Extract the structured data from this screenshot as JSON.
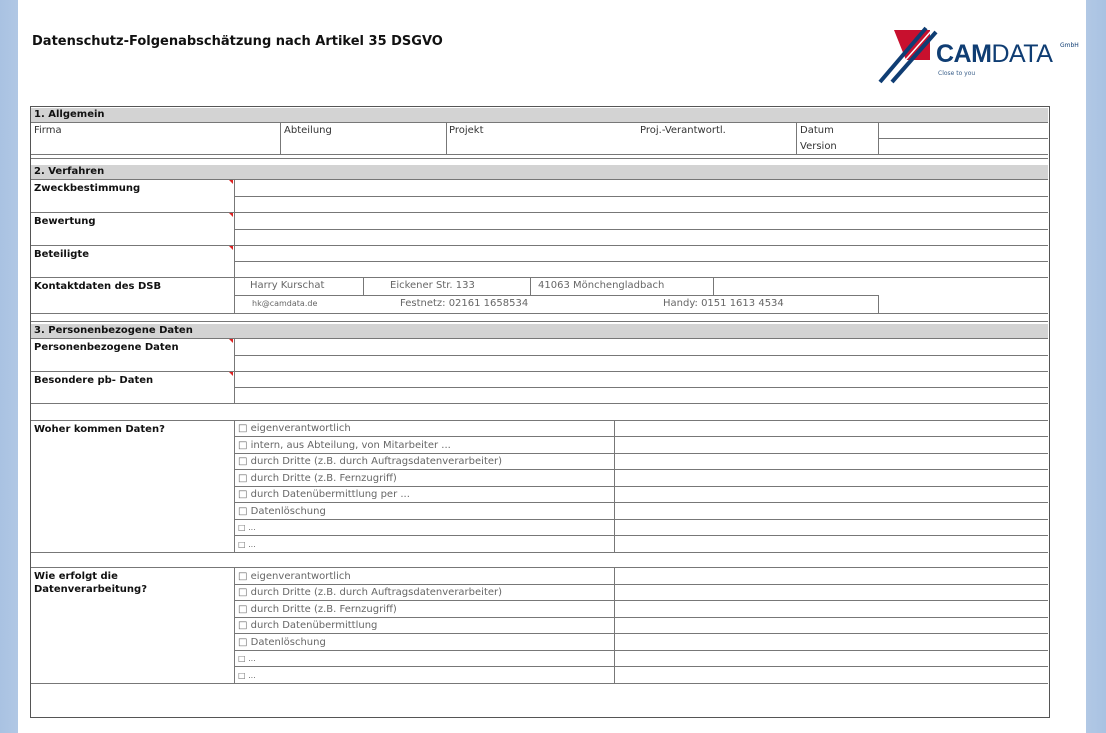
{
  "document": {
    "title": "Datenschutz-Folgenabschätzung nach Artikel 35 DSGVO",
    "logo": {
      "brand_bold": "CAM",
      "brand_light": "DATA",
      "suffix": "GmbH",
      "tagline": "Close to you"
    }
  },
  "section1": {
    "header": "1. Allgemein",
    "labels": {
      "firma": "Firma",
      "abteilung": "Abteilung",
      "projekt": "Projekt",
      "verantwortl": "Proj.-Verantwortl.",
      "datum": "Datum",
      "version": "Version"
    }
  },
  "section2": {
    "header": "2. Verfahren",
    "zweck": "Zweckbestimmung",
    "bewertung": "Bewertung",
    "beteiligte": "Beteiligte",
    "kontakt_label": "Kontaktdaten des DSB",
    "contact": {
      "name": "Harry Kurschat",
      "street": "Eickener Str. 133",
      "city": "41063 Mönchengladbach",
      "email": "hk@camdata.de",
      "festnetz": "Festnetz: 02161 1658534",
      "handy": "Handy: 0151 1613 4534"
    }
  },
  "section3": {
    "header": "3. Personenbezogene Daten",
    "pb_daten": "Personenbezogene Daten",
    "besondere": "Besondere pb- Daten",
    "woher": {
      "label": "Woher kommen Daten?",
      "options": [
        "□ eigenverantwortlich",
        "□ intern, aus Abteilung, von Mitarbeiter ...",
        "□ durch Dritte (z.B. durch Auftragsdatenverarbeiter)",
        "□ durch Dritte (z.B. Fernzugriff)",
        "□ durch Datenübermittlung per ...",
        "□ Datenlöschung",
        "□ ...",
        "□ ..."
      ]
    },
    "wie": {
      "label_line1": "Wie erfolgt die",
      "label_line2": "Datenverarbeitung?",
      "options": [
        "□ eigenverantwortlich",
        "□ durch Dritte (z.B. durch Auftragsdatenverarbeiter)",
        "□ durch Dritte (z.B. Fernzugriff)",
        "□ durch Datenübermittlung",
        "□ Datenlöschung",
        "□ ...",
        "□ ..."
      ]
    }
  }
}
